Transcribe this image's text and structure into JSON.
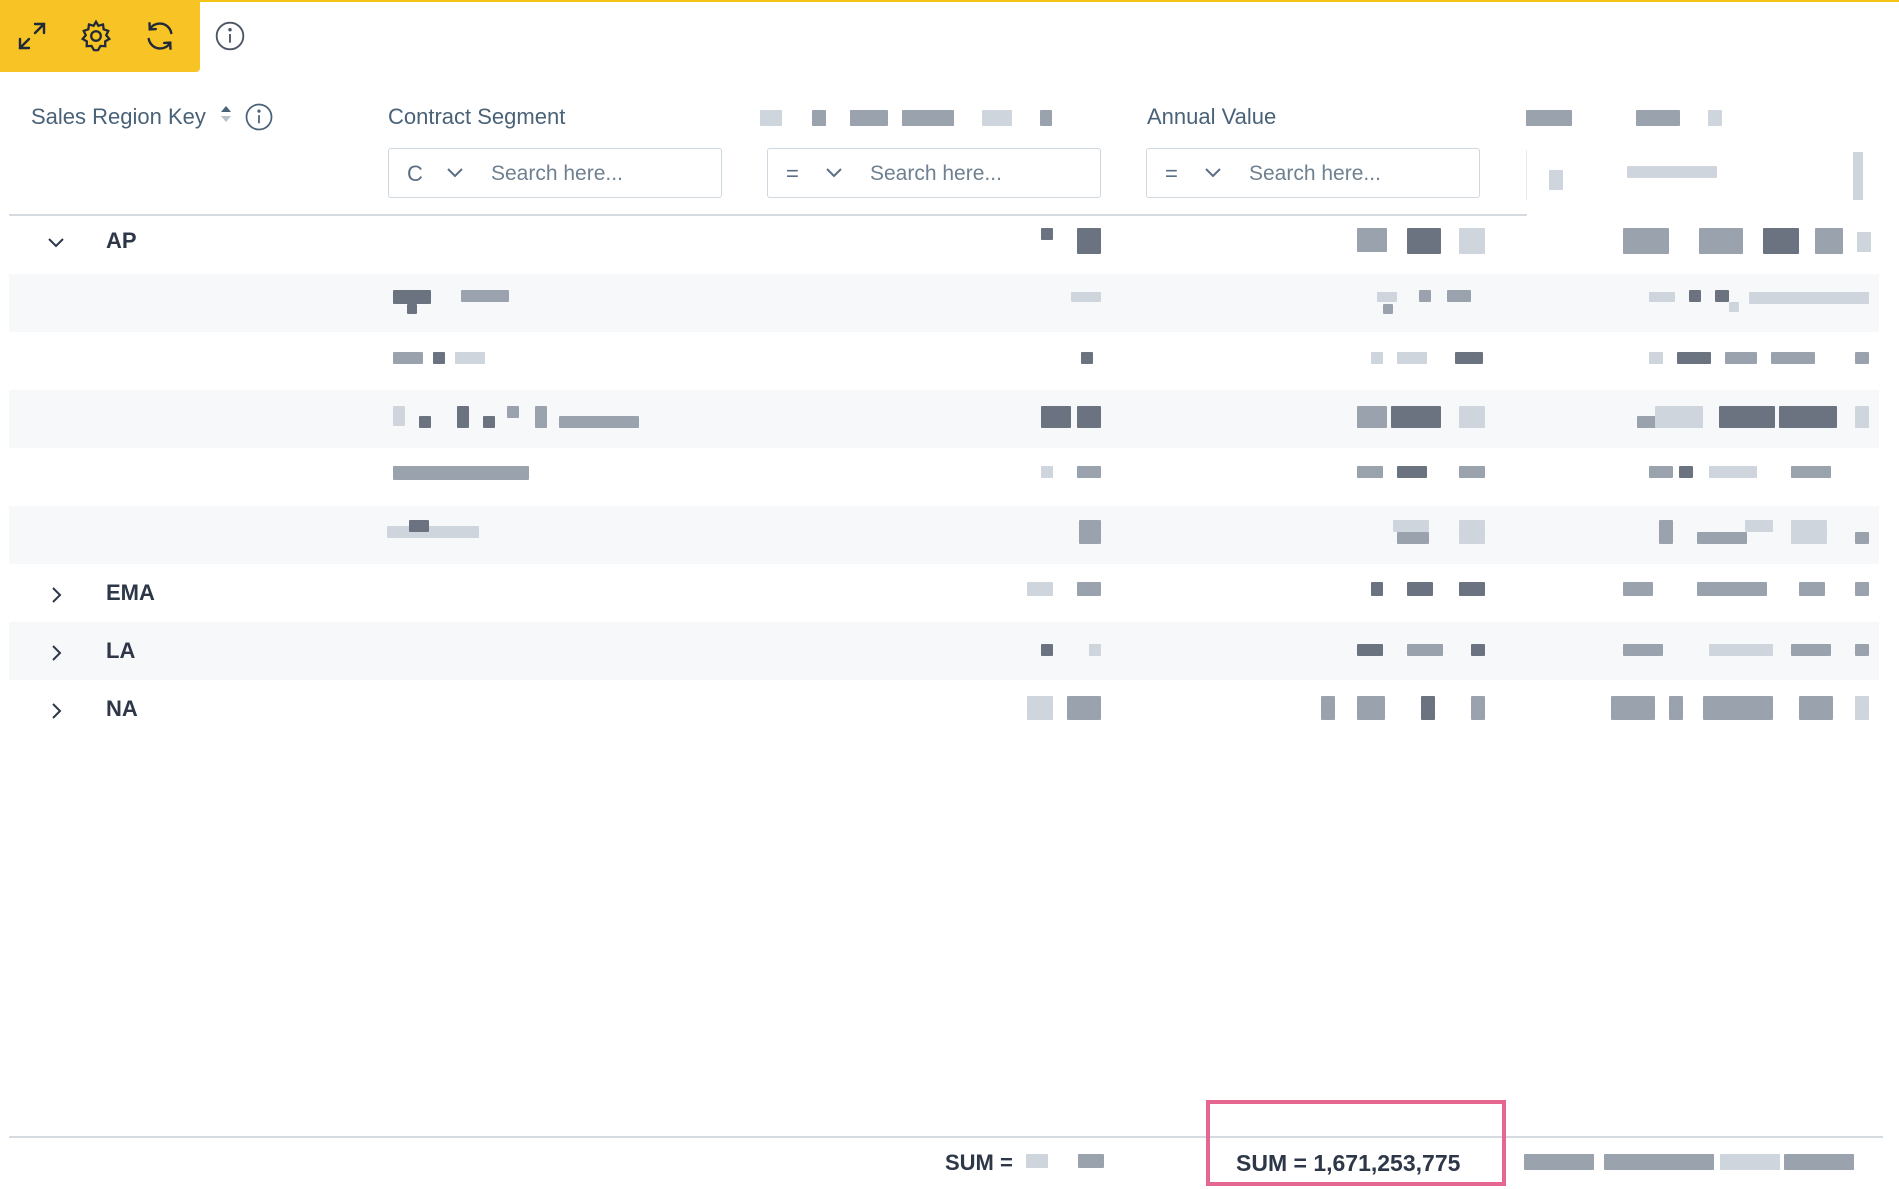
{
  "toolbar": {
    "icons": [
      "expand-icon",
      "gear-icon",
      "refresh-icon"
    ],
    "info_icon": "info-icon",
    "accent": "#f7c325"
  },
  "columns": {
    "sales_region_key": "Sales Region Key",
    "contract_segment": "Contract Segment",
    "annual_value": "Annual Value"
  },
  "filters": {
    "contract_segment": {
      "operator": "C",
      "placeholder": "Search here..."
    },
    "redacted_column": {
      "operator": "=",
      "placeholder": "Search here..."
    },
    "annual_value": {
      "operator": "=",
      "placeholder": "Search here..."
    }
  },
  "groups": [
    {
      "key": "AP",
      "expanded": true
    },
    {
      "key": "EMA",
      "expanded": false
    },
    {
      "key": "LA",
      "expanded": false
    },
    {
      "key": "NA",
      "expanded": false
    }
  ],
  "footer": {
    "sum_prefix": "SUM =",
    "annual_value_sum": "SUM = 1,671,253,775"
  },
  "colors": {
    "highlight_box": "#e5668e",
    "header_text": "#4a6278"
  }
}
